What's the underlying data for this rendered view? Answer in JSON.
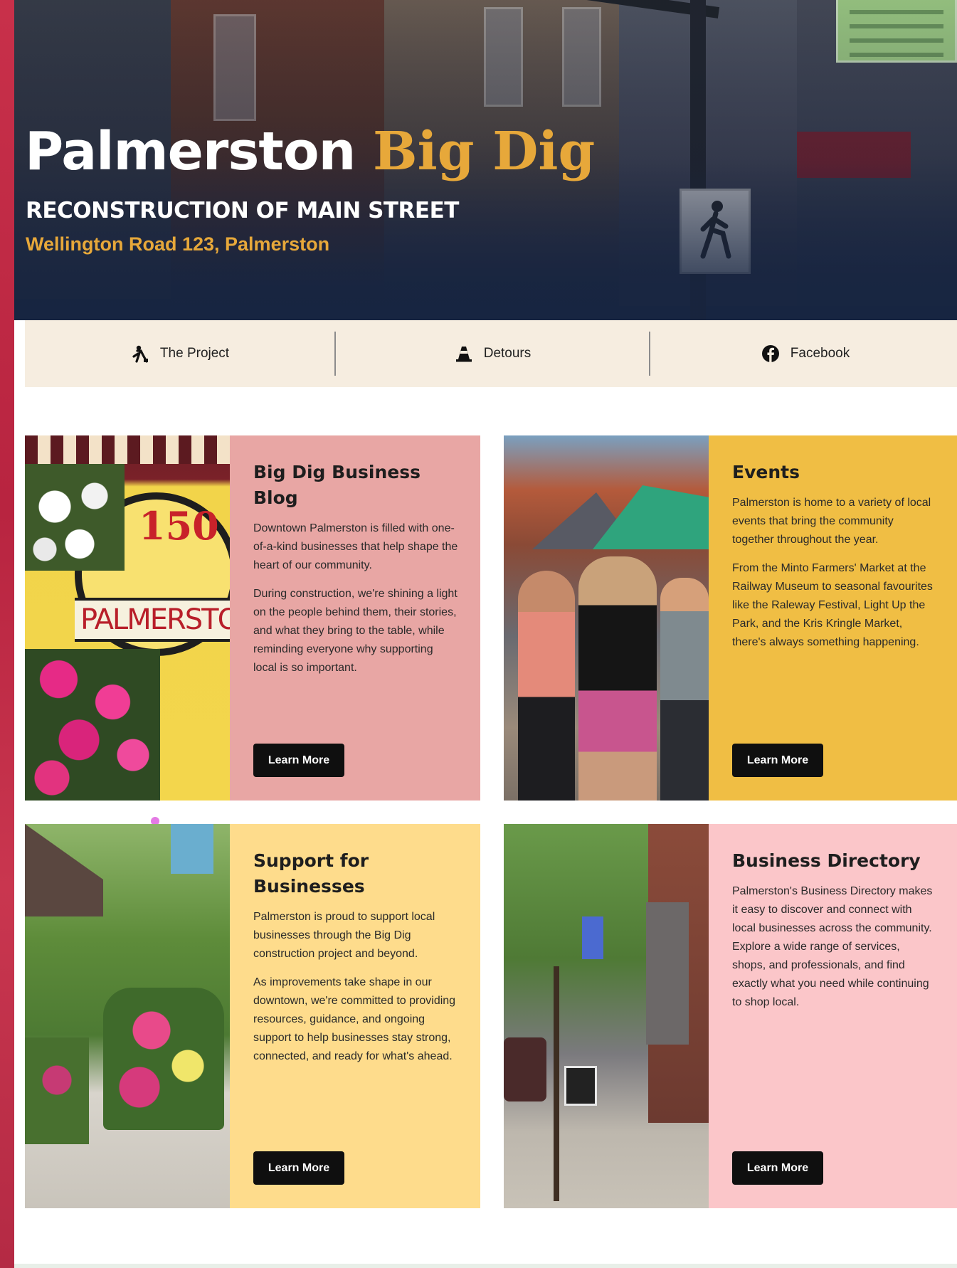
{
  "hero": {
    "title_main": "Palmerston",
    "title_accent": "Big Dig",
    "subtitle": "RECONSTRUCTION OF MAIN STREET",
    "address": "Wellington Road 123, Palmerston"
  },
  "nav": {
    "items": [
      {
        "label": "The Project",
        "icon": "construction-worker-icon"
      },
      {
        "label": "Detours",
        "icon": "traffic-cone-icon"
      },
      {
        "label": "Facebook",
        "icon": "facebook-icon"
      }
    ]
  },
  "cards": [
    {
      "title": "Big Dig Business Blog",
      "paragraphs": [
        "Downtown Palmerston is filled with one-of-a-kind businesses that help shape the heart of our community.",
        "During construction, we're shining a light on the people behind them, their stories, and what they bring to the table, while reminding everyone why supporting local is so important."
      ],
      "button": "Learn More",
      "photo_text": {
        "number": "150",
        "name": "PALMERSTON"
      },
      "color": "#e8a6a4"
    },
    {
      "title": "Events",
      "paragraphs": [
        "Palmerston is home to a variety of local events that bring the community together throughout the year.",
        "From the Minto Farmers' Market at the Railway Museum to seasonal favourites like the Raleway Festival, Light Up the Park, and the Kris Kringle Market, there's always something happening."
      ],
      "button": "Learn More",
      "color": "#f0be44"
    },
    {
      "title": "Support for Businesses",
      "paragraphs": [
        "Palmerston is proud to support local businesses through the Big Dig construction project and beyond.",
        "As improvements take shape in our downtown, we're committed to providing resources, guidance, and ongoing support to help businesses stay strong, connected, and ready for what's ahead."
      ],
      "button": "Learn More",
      "color": "#fedc8c"
    },
    {
      "title": "Business Directory",
      "paragraphs": [
        "Palmerston's Business Directory makes it easy to discover and connect with local businesses across the community. Explore a wide range of services, shops, and professionals, and find exactly what you need while continuing to shop local."
      ],
      "button": "Learn More",
      "color": "#fbc6c9"
    }
  ],
  "colors": {
    "accent": "#e7a83a",
    "hero_bg": "#1c2a45",
    "nav_bg": "#f6ede0",
    "button_bg": "#0f0f0f"
  }
}
